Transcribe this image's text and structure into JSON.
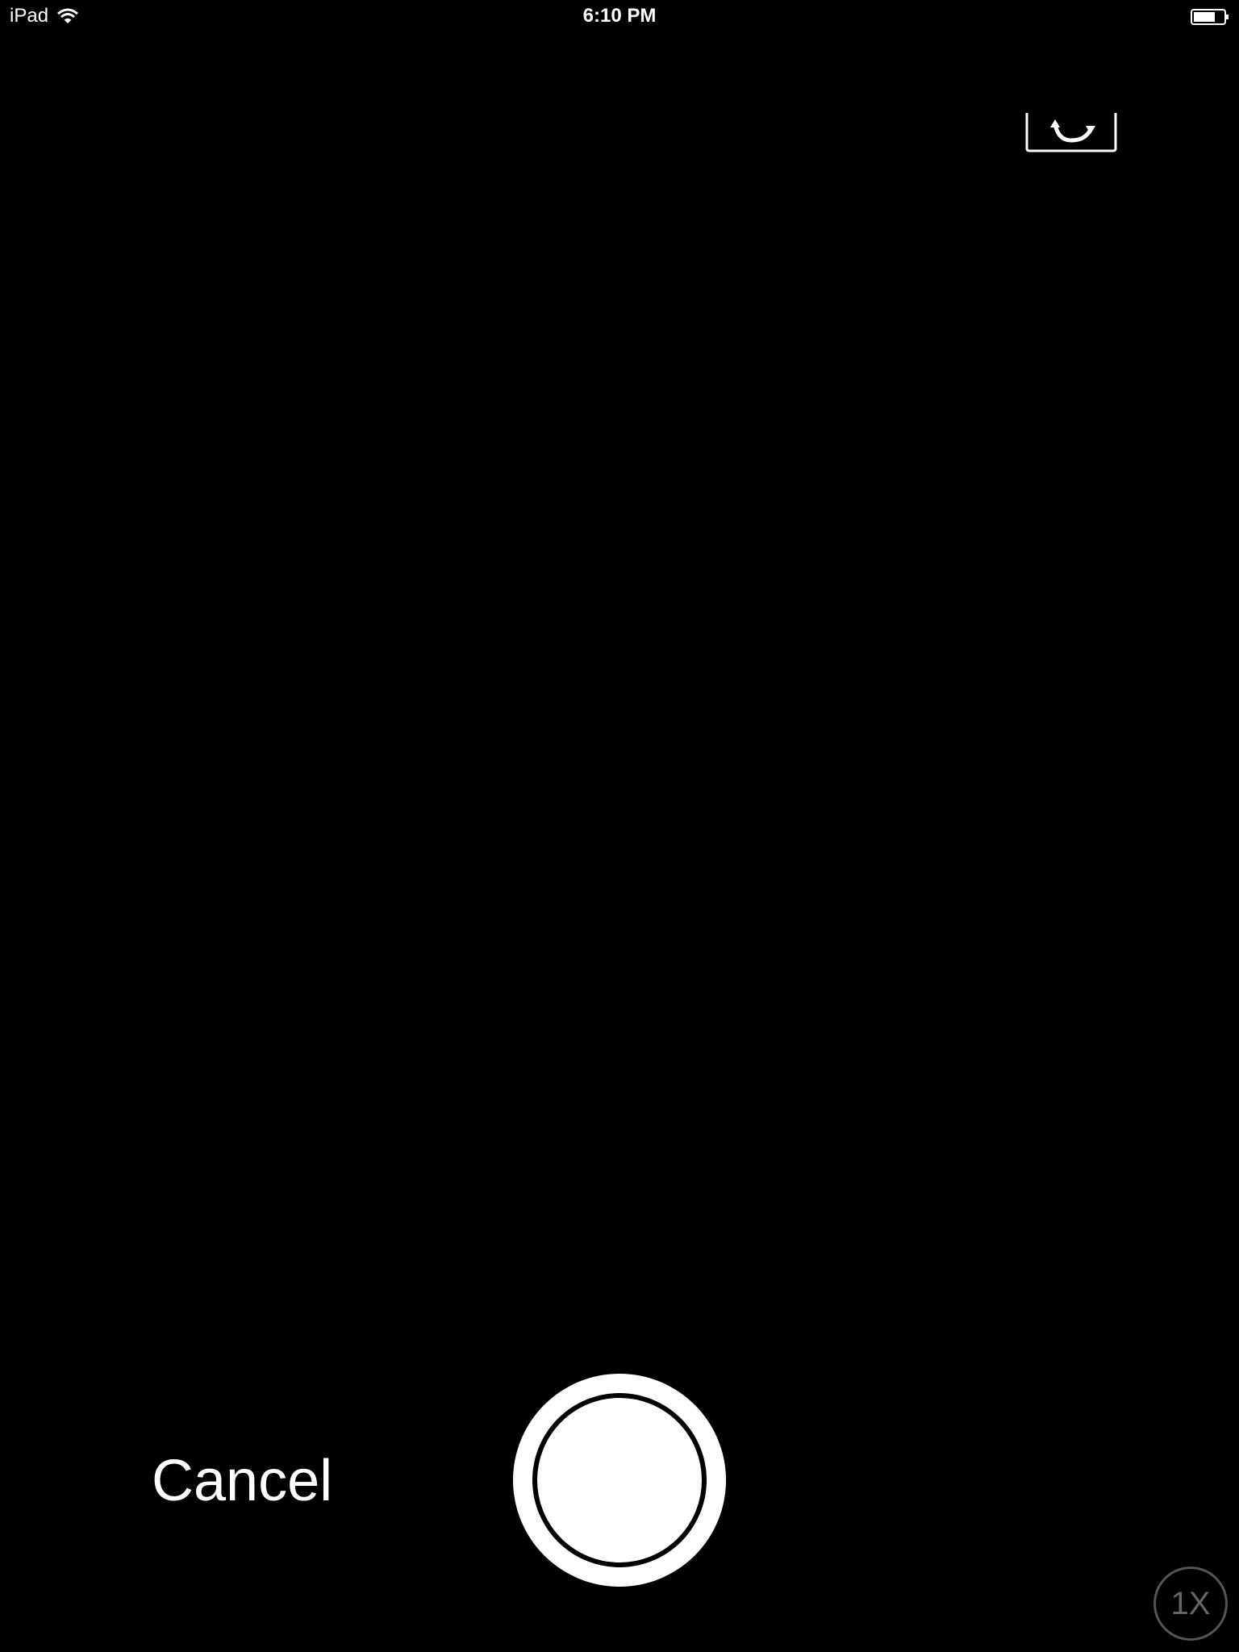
{
  "status_bar": {
    "carrier": "iPad",
    "time": "6:10 PM"
  },
  "camera": {
    "cancel_label": "Cancel",
    "zoom_label": "1X"
  },
  "icons": {
    "wifi": "wifi-icon",
    "battery": "battery-icon",
    "flip_camera": "flip-camera-icon",
    "shutter": "shutter-icon"
  },
  "colors": {
    "background": "#000000",
    "foreground": "#ffffff",
    "zoom_ring": "#555555"
  }
}
